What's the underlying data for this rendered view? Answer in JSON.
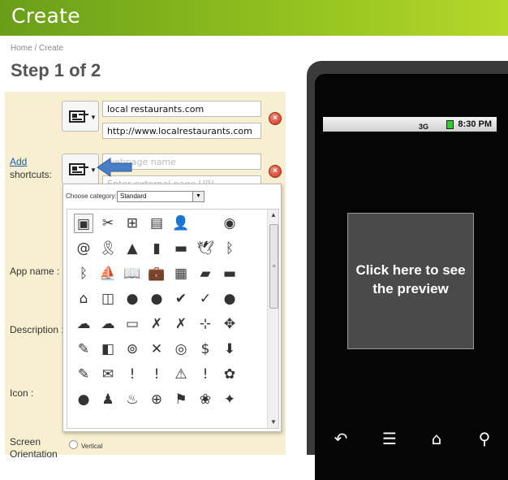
{
  "header": {
    "title": "Create"
  },
  "breadcrumb": "Home / Create",
  "step_title": "Step 1 of 2",
  "form": {
    "add_link": "Add",
    "shortcuts_label": "shortcuts:",
    "app_name_label": "App name :",
    "description_label": "Description :",
    "icon_label": "Icon :",
    "screen_label": "Screen",
    "orientation_label": "Orientation",
    "vertical_label": "Vertical",
    "shortcut1": {
      "name": "local restaurants.com",
      "url": "http://www.localrestaurants.com"
    },
    "shortcut2": {
      "name_placeholder": "webpage name",
      "url_placeholder": "Enter external page URL"
    }
  },
  "icon_picker": {
    "category_label": "Choose category:",
    "category_value": "Standard",
    "icons": [
      [
        "contact-card-icon",
        "scissors-icon",
        "add-page-icon",
        "notebook-icon",
        "user-icon",
        "apple-icon",
        "record-icon"
      ],
      [
        "at-sign-icon",
        "award-ribbon-icon",
        "area-chart-icon",
        "bar-chart-icon",
        "battery-icon",
        "bird-icon",
        "bluetooth-icon"
      ],
      [
        "bluetooth-circle-icon",
        "boat-icon",
        "open-book-icon",
        "briefcase-icon",
        "calculator-icon",
        "calendar-icon",
        "chat-bubble-icon"
      ],
      [
        "tag-icon",
        "comments-icon",
        "speech-bubbles-icon",
        "conversation-icon",
        "checkmark-circle-icon",
        "checkmark-icon",
        "circle-icon"
      ],
      [
        "cloud-icon",
        "cloud-outline-icon",
        "laptop-icon",
        "wrench-icon",
        "tools-icon",
        "share-icon",
        "move-icon"
      ],
      [
        "cart-icon",
        "copy-icon",
        "cylinder-icon",
        "delete-doc-icon",
        "target-icon",
        "dollar-icon",
        "download-icon"
      ],
      [
        "edit-icon",
        "mail-open-icon",
        "warning-octagon-icon",
        "exclamation-circle-icon",
        "warning-triangle-icon",
        "exclamation-icon",
        "fan-icon"
      ],
      [
        "sphere-icon",
        "fireman-icon",
        "campfire-icon",
        "first-aid-icon",
        "flag-icon",
        "flower-icon",
        "compass-icon"
      ]
    ],
    "glyphs": [
      [
        "▣",
        "✂",
        "⊞",
        "▤",
        "👤",
        "",
        "◉"
      ],
      [
        "@",
        "🎗",
        "▲",
        "▮",
        "▬",
        "🕊",
        "ᛒ"
      ],
      [
        "ᛒ",
        "⛵",
        "📖",
        "💼",
        "▦",
        "▰",
        "▬"
      ],
      [
        "⌂",
        "◫",
        "●",
        "●",
        "✔",
        "✓",
        "●"
      ],
      [
        "☁",
        "☁",
        "▭",
        "✗",
        "✗",
        "⊹",
        "✥"
      ],
      [
        "✎",
        "◧",
        "⊚",
        "✕",
        "◎",
        "$",
        "⬇"
      ],
      [
        "✎",
        "✉",
        "!",
        "!",
        "⚠",
        "!",
        "✿"
      ],
      [
        "●",
        "♟",
        "♨",
        "⊕",
        "⚑",
        "❀",
        "✦"
      ]
    ]
  },
  "phone": {
    "status_time": "8:30 PM",
    "status_signal": "3G",
    "preview_text": "Click here to see the preview"
  }
}
